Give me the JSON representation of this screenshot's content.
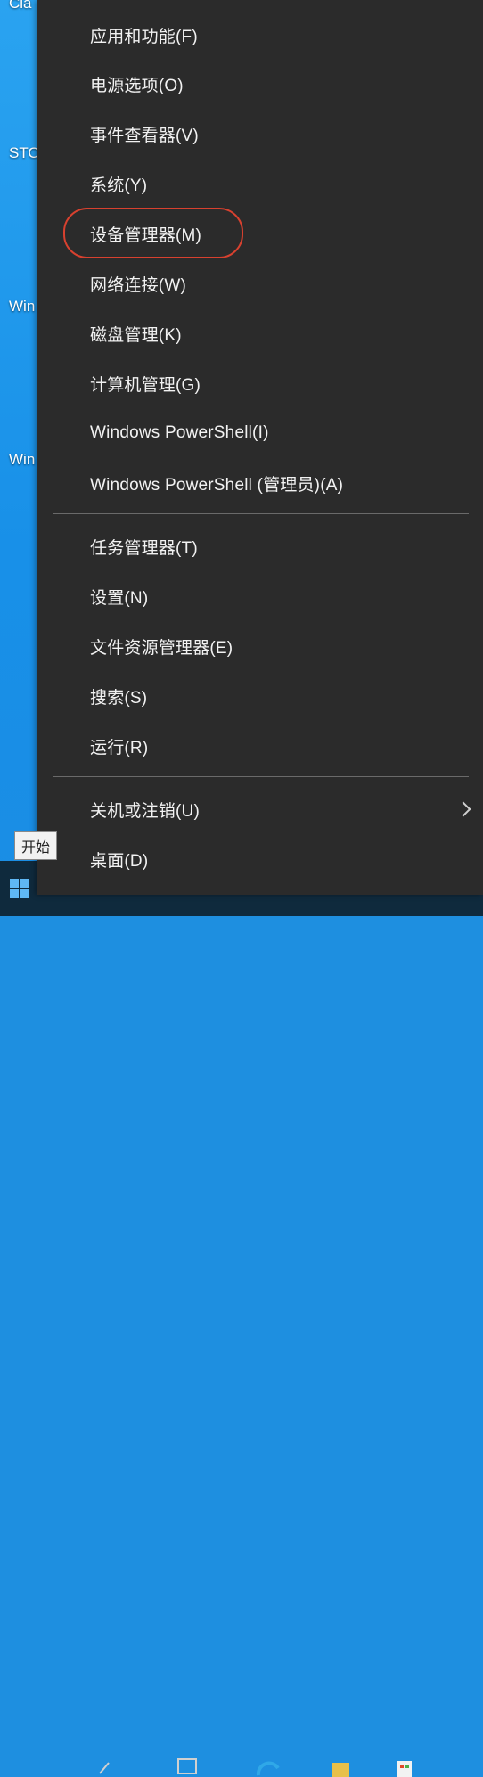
{
  "desktop": {
    "labels": [
      "Cla",
      "STO",
      "Win",
      "Win"
    ]
  },
  "start": {
    "tooltip": "开始"
  },
  "menu": {
    "group1": [
      {
        "label": "应用和功能(F)"
      },
      {
        "label": "电源选项(O)"
      },
      {
        "label": "事件查看器(V)"
      },
      {
        "label": "系统(Y)"
      },
      {
        "label": "设备管理器(M)"
      },
      {
        "label": "网络连接(W)"
      },
      {
        "label": "磁盘管理(K)"
      },
      {
        "label": "计算机管理(G)"
      },
      {
        "label": "Windows PowerShell(I)"
      },
      {
        "label": "Windows PowerShell (管理员)(A)"
      }
    ],
    "group2": [
      {
        "label": "任务管理器(T)"
      },
      {
        "label": "设置(N)"
      },
      {
        "label": "文件资源管理器(E)"
      },
      {
        "label": "搜索(S)"
      },
      {
        "label": "运行(R)"
      }
    ],
    "group3": [
      {
        "label": "关机或注销(U)",
        "icon": "chevron-right-icon"
      },
      {
        "label": "桌面(D)"
      }
    ]
  },
  "colors": {
    "menu_bg": "#2b2b2b",
    "highlight": "#d8412f",
    "desktop": "#1e8fe0"
  }
}
